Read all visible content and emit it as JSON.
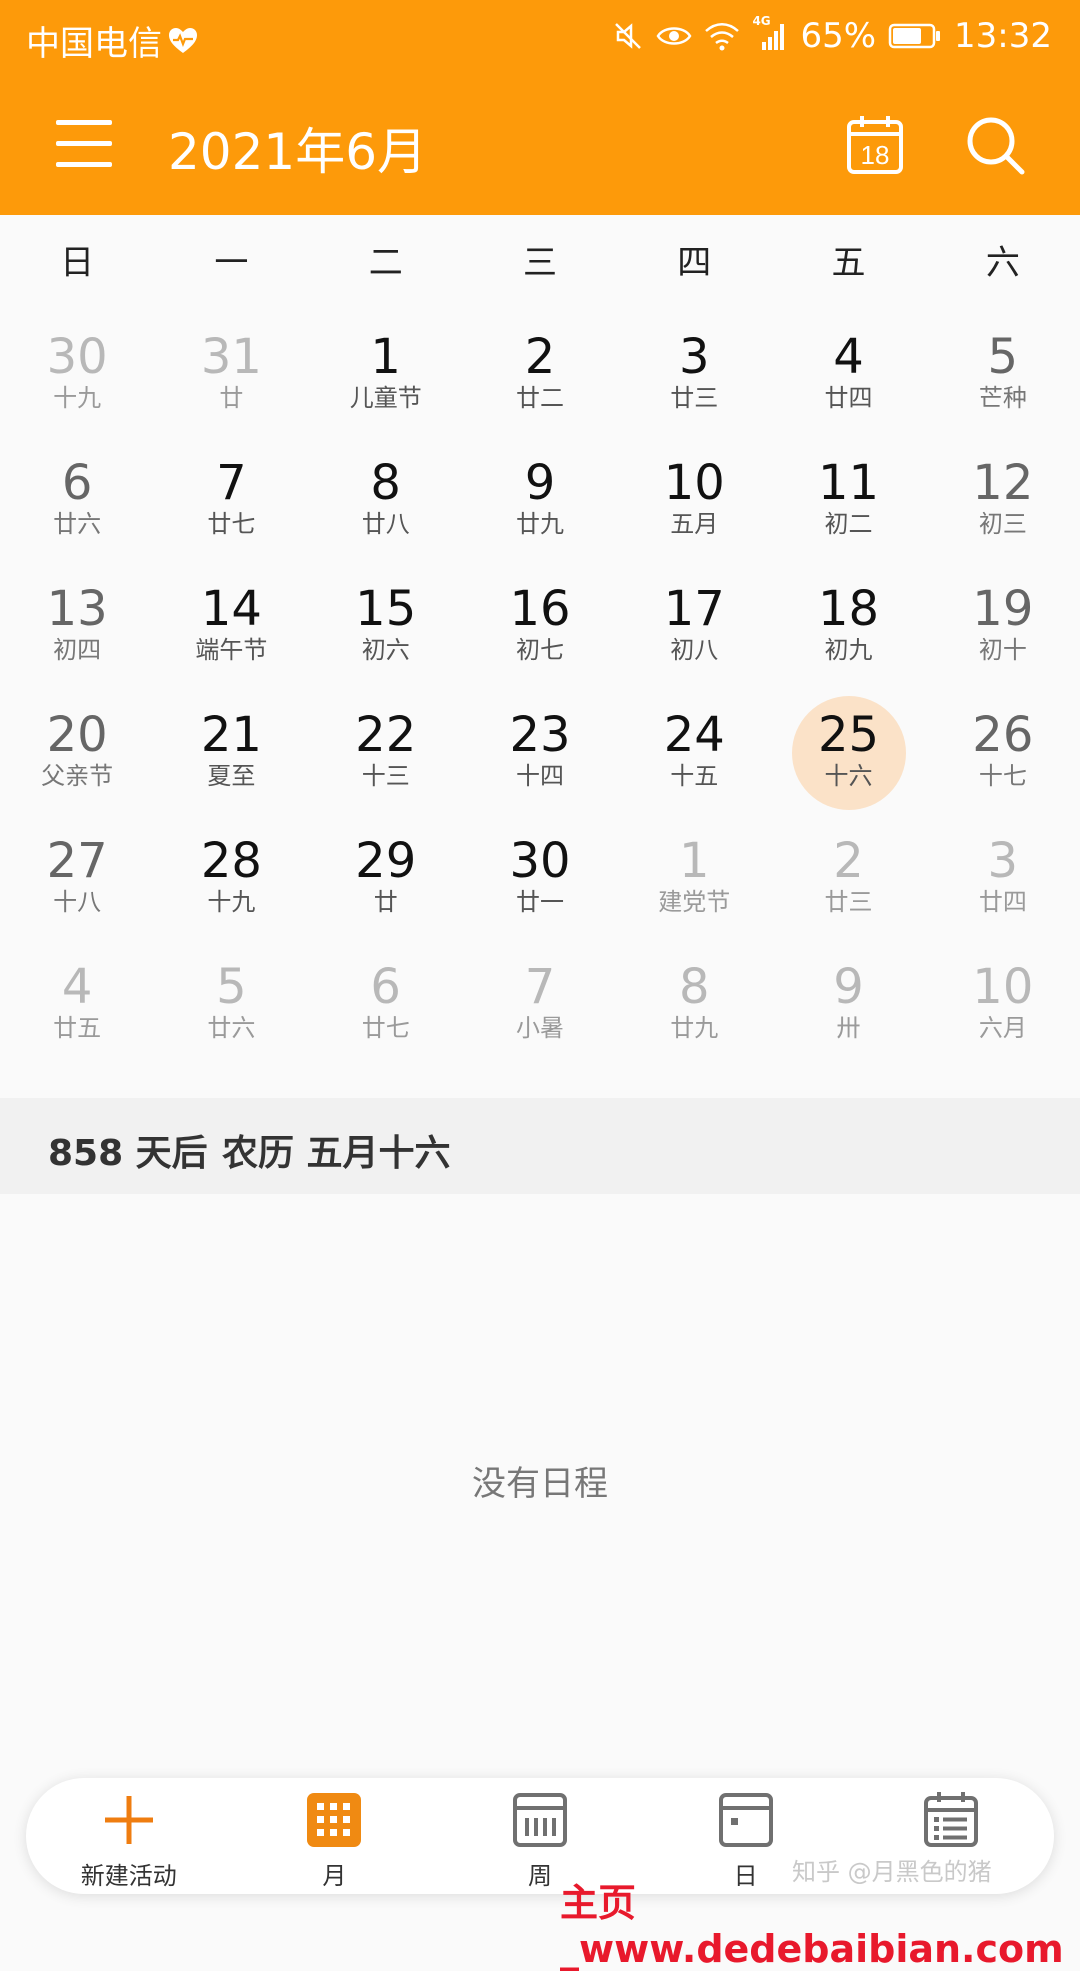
{
  "status_bar": {
    "carrier": "中国电信",
    "network": "4G",
    "battery_percent": "65%",
    "time": "13:32"
  },
  "app_bar": {
    "title": "2021年6月",
    "today_icon_number": "18"
  },
  "weekdays": [
    "日",
    "一",
    "二",
    "三",
    "四",
    "五",
    "六"
  ],
  "calendar": {
    "weeks": [
      [
        {
          "d": "30",
          "l": "十九",
          "in": false
        },
        {
          "d": "31",
          "l": "廿",
          "in": false
        },
        {
          "d": "1",
          "l": "儿童节",
          "in": true
        },
        {
          "d": "2",
          "l": "廿二",
          "in": true
        },
        {
          "d": "3",
          "l": "廿三",
          "in": true
        },
        {
          "d": "4",
          "l": "廿四",
          "in": true
        },
        {
          "d": "5",
          "l": "芒种",
          "in": true
        }
      ],
      [
        {
          "d": "6",
          "l": "廿六",
          "in": true
        },
        {
          "d": "7",
          "l": "廿七",
          "in": true
        },
        {
          "d": "8",
          "l": "廿八",
          "in": true
        },
        {
          "d": "9",
          "l": "廿九",
          "in": true
        },
        {
          "d": "10",
          "l": "五月",
          "in": true
        },
        {
          "d": "11",
          "l": "初二",
          "in": true
        },
        {
          "d": "12",
          "l": "初三",
          "in": true
        }
      ],
      [
        {
          "d": "13",
          "l": "初四",
          "in": true
        },
        {
          "d": "14",
          "l": "端午节",
          "in": true
        },
        {
          "d": "15",
          "l": "初六",
          "in": true
        },
        {
          "d": "16",
          "l": "初七",
          "in": true
        },
        {
          "d": "17",
          "l": "初八",
          "in": true
        },
        {
          "d": "18",
          "l": "初九",
          "in": true
        },
        {
          "d": "19",
          "l": "初十",
          "in": true
        }
      ],
      [
        {
          "d": "20",
          "l": "父亲节",
          "in": true
        },
        {
          "d": "21",
          "l": "夏至",
          "in": true
        },
        {
          "d": "22",
          "l": "十三",
          "in": true
        },
        {
          "d": "23",
          "l": "十四",
          "in": true
        },
        {
          "d": "24",
          "l": "十五",
          "in": true
        },
        {
          "d": "25",
          "l": "十六",
          "in": true,
          "selected": true
        },
        {
          "d": "26",
          "l": "十七",
          "in": true
        }
      ],
      [
        {
          "d": "27",
          "l": "十八",
          "in": true
        },
        {
          "d": "28",
          "l": "十九",
          "in": true
        },
        {
          "d": "29",
          "l": "廿",
          "in": true
        },
        {
          "d": "30",
          "l": "廿一",
          "in": true
        },
        {
          "d": "1",
          "l": "建党节",
          "in": false
        },
        {
          "d": "2",
          "l": "廿三",
          "in": false
        },
        {
          "d": "3",
          "l": "廿四",
          "in": false
        }
      ],
      [
        {
          "d": "4",
          "l": "廿五",
          "in": false
        },
        {
          "d": "5",
          "l": "廿六",
          "in": false
        },
        {
          "d": "6",
          "l": "廿七",
          "in": false
        },
        {
          "d": "7",
          "l": "小暑",
          "in": false
        },
        {
          "d": "8",
          "l": "廿九",
          "in": false
        },
        {
          "d": "9",
          "l": "卅",
          "in": false
        },
        {
          "d": "10",
          "l": "六月",
          "in": false
        }
      ]
    ]
  },
  "selected_info": {
    "days_after": "858 天后",
    "lunar": "农历 五月十六"
  },
  "empty_message": "没有日程",
  "bottom_nav": [
    {
      "label": "新建活动",
      "icon": "plus-icon"
    },
    {
      "label": "月",
      "icon": "month-grid-icon",
      "active": true
    },
    {
      "label": "周",
      "icon": "week-icon"
    },
    {
      "label": "日",
      "icon": "day-icon"
    },
    {
      "label": "",
      "icon": "agenda-icon"
    }
  ],
  "watermark": "知乎 @月黑色的猪",
  "footer_text": "主页_www.dedebaibian.com",
  "colors": {
    "accent": "#fd9a0a",
    "selected_bg": "#fbe2c8",
    "footer_red": "#e8192c"
  }
}
